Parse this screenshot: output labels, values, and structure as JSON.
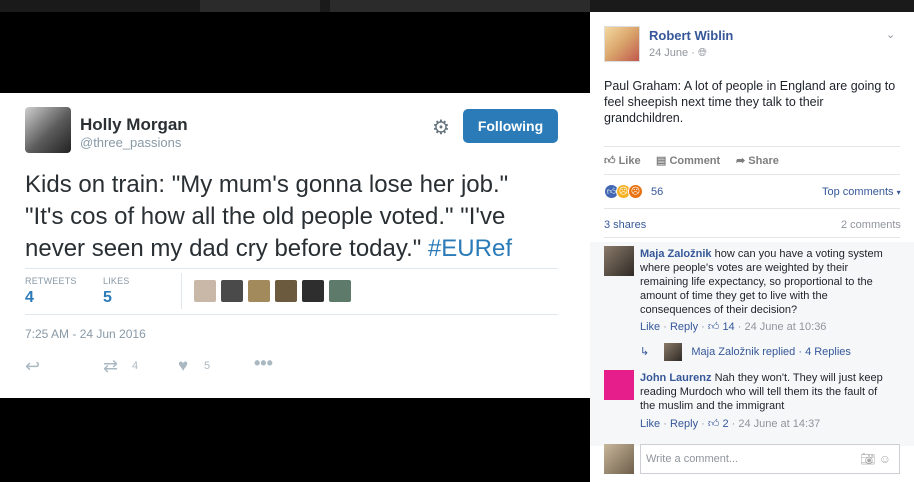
{
  "tweet": {
    "name": "Holly Morgan",
    "handle": "@three_passions",
    "follow_label": "Following",
    "text_lines": [
      "Kids on train: \"My mum's gonna lose her job.\"",
      "\"It's cos of how all the old people voted.\" \"I've",
      "never seen my dad cry before today.\" "
    ],
    "hashtag": "#EURef",
    "retweets_label": "RETWEETS",
    "retweets": "4",
    "likes_label": "LIKES",
    "likes": "5",
    "time": "7:25 AM - 24 Jun 2016",
    "action_retweets": "4",
    "action_likes": "5",
    "icons": [
      "settings-icon",
      "reply-icon",
      "retweet-icon",
      "heart-icon",
      "more-icon"
    ]
  },
  "post": {
    "author": "Robert Wiblin",
    "date": "24 June",
    "text": "Paul Graham: A lot of people in England are going to feel sheepish next time they talk to their grandchildren.",
    "actions": {
      "like": "Like",
      "comment": "Comment",
      "share": "Share"
    },
    "reactions_count": "56",
    "top_comments": "Top comments",
    "shares": "3 shares",
    "comments_count": "2 comments"
  },
  "comments": [
    {
      "name": "Maja Založnik",
      "text": "how can you have a voting system where people's votes are weighted by their remaining life expectancy, so proportional to the amount of time they get to live with the consequences of their decision?",
      "like": "Like",
      "reply": "Reply",
      "likes": "14",
      "time": "24 June at 10:36",
      "reply_summary_name": "Maja Založnik replied",
      "reply_summary_count": "4 Replies"
    },
    {
      "name": "John Laurenz",
      "text": "Nah they won't. They will just keep reading Murdoch who will tell them its the fault of the muslim and the immigrant",
      "like": "Like",
      "reply": "Reply",
      "likes": "2",
      "time": "24 June at 14:37"
    }
  ],
  "write_placeholder": "Write a comment...",
  "colors": {
    "twitter_blue": "#2b7bb9",
    "fb_link": "#365899"
  }
}
